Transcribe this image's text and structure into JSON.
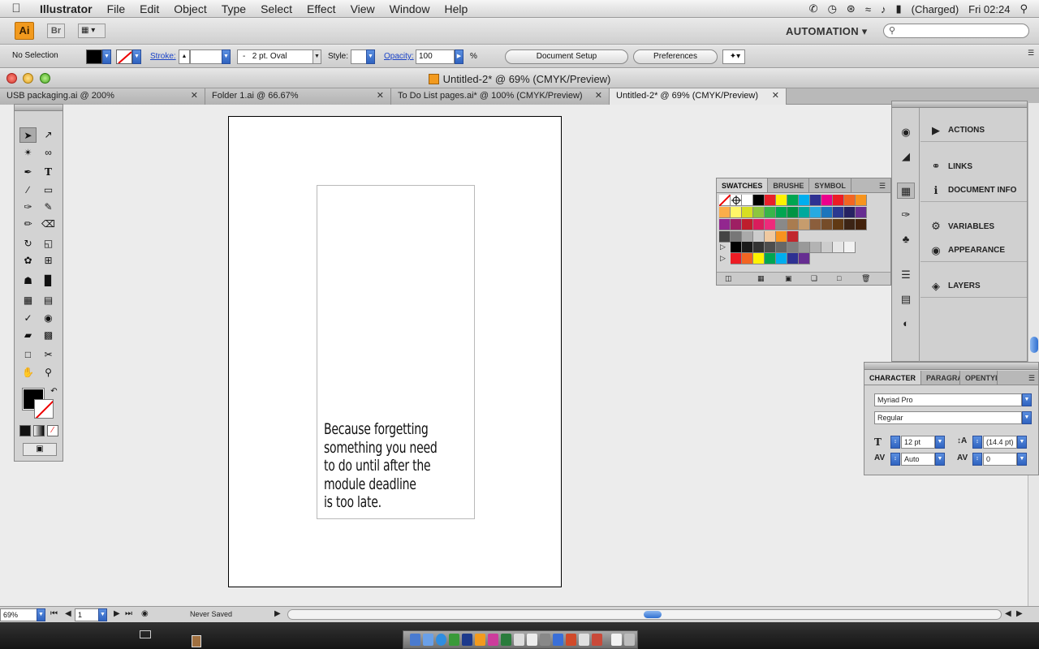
{
  "menubar": {
    "app_name": "Illustrator",
    "items": [
      "File",
      "Edit",
      "Object",
      "Type",
      "Select",
      "Effect",
      "View",
      "Window",
      "Help"
    ],
    "battery": "(Charged)",
    "clock": "Fri 02:24"
  },
  "appbar": {
    "ai_logo": "Ai",
    "bridge_label": "Br",
    "workspace": "AUTOMATION ▾"
  },
  "control": {
    "selection": "No Selection",
    "stroke_label": "Stroke:",
    "brush": "2 pt. Oval",
    "brush_prefix": "-",
    "style_label": "Style:",
    "opacity_label": "Opacity:",
    "opacity_value": "100",
    "percent": "%",
    "doc_setup": "Document Setup",
    "preferences": "Preferences"
  },
  "window": {
    "title": "Untitled-2* @ 69% (CMYK/Preview)"
  },
  "tabs": [
    {
      "label": "USB packaging.ai @ 200% (CMYK/Preview)"
    },
    {
      "label": "Folder 1.ai @ 66.67% (CMYK/Preview)"
    },
    {
      "label": "To Do List pages.ai* @ 100% (CMYK/Preview)"
    },
    {
      "label": "Untitled-2* @ 69% (CMYK/Preview)"
    }
  ],
  "artwork": {
    "lines": [
      "Because forgetting",
      "something you need",
      "to do until after the",
      "module deadline",
      "is too late."
    ]
  },
  "swatches": {
    "tabs": [
      "SWATCHES",
      "BRUSHE",
      "SYMBOL"
    ],
    "row1": [
      "#ffffff",
      "#ffffff",
      "#ffffff",
      "#000000",
      "#e8202a",
      "#fff200",
      "#00a651",
      "#00aeef",
      "#2e3192",
      "#ec008c",
      "#ed1c24",
      "#f26522",
      "#f7941d"
    ],
    "row2": [
      "#fbad4a",
      "#fff568",
      "#d7df23",
      "#8dc63f",
      "#39b54a",
      "#00a651",
      "#009444",
      "#00a99d",
      "#27aae1",
      "#1c75bc",
      "#2b3990",
      "#262262",
      "#662d91"
    ],
    "row3": [
      "#92278f",
      "#9e1f63",
      "#be1e2d",
      "#da1c5c",
      "#ee2a7b",
      "#898989",
      "#a97c50",
      "#c69c6d",
      "#8b5e3c",
      "#754c29",
      "#603913",
      "#3c2415",
      "#42210b"
    ],
    "row4": [
      "#444444",
      "#777777",
      "#aaaaaa",
      "#cccccc",
      "#f0c9a0",
      "#f7931e",
      "#c1272d"
    ],
    "row5": [
      "#000000",
      "#1a1a1a",
      "#333333",
      "#4d4d4d",
      "#666666",
      "#808080",
      "#999999",
      "#b3b3b3",
      "#cccccc",
      "#e6e6e6",
      "#f2f2f2"
    ],
    "row6": [
      "#ed1c24",
      "#f26522",
      "#fff200",
      "#00a651",
      "#00aeef",
      "#2e3192",
      "#662d91"
    ]
  },
  "dock_panels": [
    "ACTIONS",
    "LINKS",
    "DOCUMENT INFO",
    "VARIABLES",
    "APPEARANCE",
    "LAYERS"
  ],
  "character": {
    "tabs": [
      "CHARACTER",
      "PARAGRA",
      "OPENTYI"
    ],
    "font": "Myriad Pro",
    "style": "Regular",
    "size": "12 pt",
    "leading": "(14.4 pt)",
    "kerning": "Auto",
    "tracking": "0"
  },
  "status": {
    "zoom": "69%",
    "page": "1",
    "saved": "Never Saved"
  }
}
